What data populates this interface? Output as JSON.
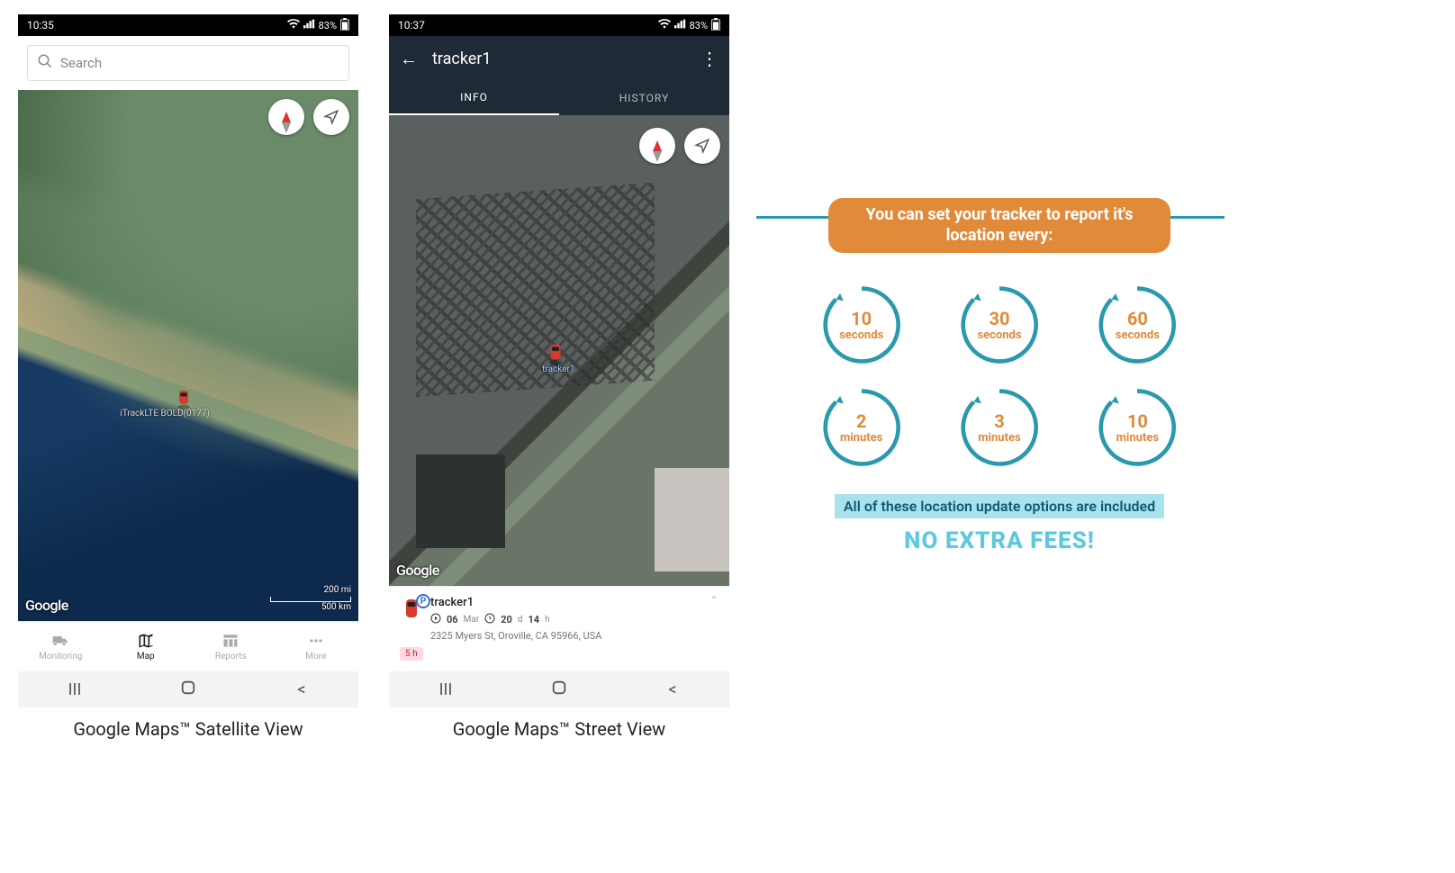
{
  "phone1": {
    "status": {
      "time": "10:35",
      "battery": "83%"
    },
    "search_placeholder": "Search",
    "pin_label": "iTrackLTE BOLD(0177)",
    "google_logo": "Google",
    "scale_top": "200 mi",
    "scale_bottom": "500 km",
    "tabs": {
      "monitoring": "Monitoring",
      "map": "Map",
      "reports": "Reports",
      "more": "More"
    },
    "caption": "Google Maps™ Satellite View"
  },
  "phone2": {
    "status": {
      "time": "10:37",
      "battery": "83%"
    },
    "appbar_title": "tracker1",
    "subtabs": {
      "info": "INFO",
      "history": "HISTORY"
    },
    "pin_label": "tracker1",
    "google_logo": "Google",
    "card": {
      "name": "tracker1",
      "date_num": "06",
      "date_month": "Mar",
      "duration_d": "20",
      "duration_d_unit": "d",
      "duration_h": "14",
      "duration_h_unit": "h",
      "address": "2325 Myers St, Oroville, CA 95966, USA",
      "badge": "5 h"
    },
    "caption": "Google Maps™ Street View"
  },
  "info": {
    "headline": "You can set your tracker to report it's location every:",
    "options": [
      {
        "n": "10",
        "u": "seconds"
      },
      {
        "n": "30",
        "u": "seconds"
      },
      {
        "n": "60",
        "u": "seconds"
      },
      {
        "n": "2",
        "u": "minutes"
      },
      {
        "n": "3",
        "u": "minutes"
      },
      {
        "n": "10",
        "u": "minutes"
      }
    ],
    "sub1": "All of these location update options are included",
    "sub2": "NO EXTRA FEES!"
  },
  "colors": {
    "accent_orange": "#e08a3a",
    "accent_teal": "#2a99ad"
  }
}
